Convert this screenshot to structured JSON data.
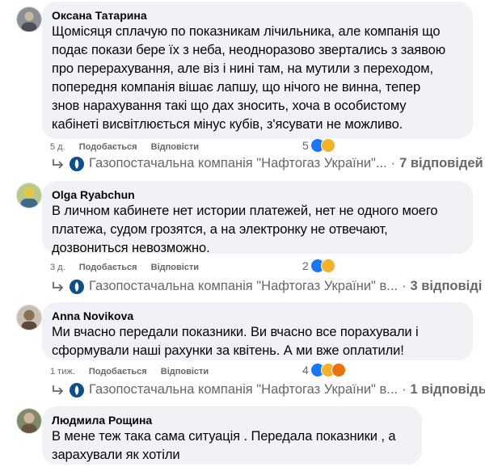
{
  "comments": [
    {
      "author": "Оксана Татарина",
      "lines": [
        "Щомісяця сплачую по показникам лічильника, але компанія що",
        "подає покази бере їх з неба, неодноразово звертались з заявою",
        "про перерахування, але віз і нині там, на мутили з переходом,",
        "попередня компанія вішає лапшу, що нічого не винна, тепер",
        "знов нарахування такі що дах зносить, хоча в особистому",
        "кабінеті висвітлюється мінус кубів, з'ясувати не можливо."
      ],
      "time": "5 д.",
      "like_label": "Подобається",
      "reply_label": "Відповісти",
      "reaction_count": "5",
      "reactions": [
        "like",
        "sad"
      ],
      "reply_summary": {
        "company": "Газопостачальна компанія \"Нафтогаз України\"...",
        "sep": "·",
        "count": "7 відповідей"
      }
    },
    {
      "author": "Olga Ryabchun",
      "lines": [
        "В личном кабинете нет истории платежей, нет не одного моего",
        "платежа, судом грозятся, а на электронку не отвечают,",
        "дозвониться невозможно."
      ],
      "time": "3 д.",
      "like_label": "Подобається",
      "reply_label": "Відповісти",
      "reaction_count": "2",
      "reactions": [
        "like",
        "sad"
      ],
      "reply_summary": {
        "company": "Газопостачальна компанія \"Нафтогаз України\" в...",
        "sep": "·",
        "count": "3 відповіді"
      }
    },
    {
      "author": "Anna Novikova",
      "lines": [
        "Ми вчасно передали показники. Ви вчасно все порахували і",
        "сформували наші рахунки за квітень. А ми вже оплатили!"
      ],
      "time": "1 тиж.",
      "like_label": "Подобається",
      "reply_label": "Відповісти",
      "reaction_count": "4",
      "reactions": [
        "like",
        "sad",
        "angry"
      ],
      "reply_summary": {
        "company": "Газопостачальна компанія \"Нафтогаз України\" в...",
        "sep": "·",
        "count": "1 відповідь"
      }
    },
    {
      "author": "Людмила Рощина",
      "lines": [
        "В мене теж така сама ситуація . Передала показники , а",
        "зарахували як хотіли"
      ]
    }
  ],
  "colors": {
    "bubble": "#f0f2f5",
    "meta": "#65676b",
    "like": "#1877f2",
    "sad": "#f7b125",
    "angry": "#e9710f"
  }
}
